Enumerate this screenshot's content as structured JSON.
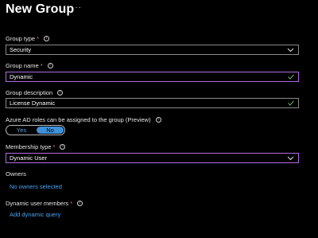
{
  "header": {
    "title": "New Group",
    "more_label": "···"
  },
  "form": {
    "group_type": {
      "label": "Group type",
      "required": "*",
      "value": "Security"
    },
    "group_name": {
      "label": "Group name",
      "required": "*",
      "value": "Dynamic"
    },
    "group_description": {
      "label": "Group description",
      "value": "License Dynamic"
    },
    "azure_ad_roles": {
      "label": "Azure AD roles can be assigned to the group (Preview)",
      "yes": "Yes",
      "no": "No",
      "selected": "No"
    },
    "membership_type": {
      "label": "Membership type",
      "required": "*",
      "value": "Dynamic User"
    },
    "owners": {
      "label": "Owners",
      "link": "No owners selected"
    },
    "dynamic_members": {
      "label": "Dynamic user members",
      "required": "*",
      "link": "Add dynamic query"
    }
  },
  "colors": {
    "accent": "#3f90d8",
    "link": "#4aa3f2",
    "required": "#f1707b",
    "focus_border": "#b06be0",
    "valid": "#6bb56b"
  },
  "icons": {
    "info": "info-icon",
    "dropdown": "chevron-down-icon",
    "valid": "checkmark-icon"
  }
}
